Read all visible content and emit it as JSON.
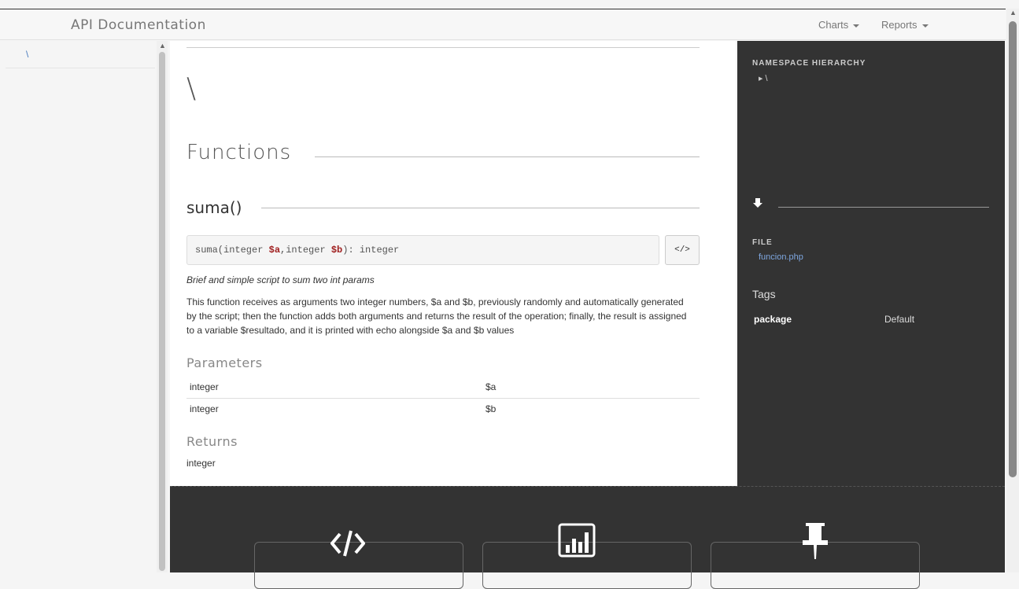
{
  "header": {
    "brand": "API Documentation",
    "nav": [
      {
        "label": "Charts"
      },
      {
        "label": "Reports"
      }
    ]
  },
  "left_nav": {
    "items": [
      {
        "label": "\\"
      }
    ]
  },
  "main": {
    "namespace_title": "\\",
    "section_title": "Functions",
    "function": {
      "name": "suma()",
      "signature": {
        "prefix": "suma(integer ",
        "arg1": "$a",
        "mid": ",integer ",
        "arg2": "$b",
        "suffix": "): integer"
      },
      "source_button": "</>",
      "summary": "Brief and simple script to sum two int params",
      "description": "This function receives as arguments two integer numbers, $a and $b, previously randomly and automatically generated by the script; then the function adds both arguments and returns the result of the operation; finally, the result is assigned to a variable $resultado, and it is printed with echo alongside $a and $b values",
      "parameters_title": "Parameters",
      "parameters": [
        {
          "type": "integer",
          "name": "$a"
        },
        {
          "type": "integer",
          "name": "$b"
        }
      ],
      "returns_title": "Returns",
      "returns": "integer"
    }
  },
  "sidebar": {
    "namespace_label": "NAMESPACE HIERARCHY",
    "namespace_root": "\\",
    "file_label": "FILE",
    "file_name": "funcion.php",
    "tags_title": "Tags",
    "tags": [
      {
        "key": "package",
        "value": "Default"
      }
    ]
  },
  "footer": {
    "icons": [
      "code-icon",
      "bar-chart-icon",
      "pushpin-icon"
    ]
  }
}
